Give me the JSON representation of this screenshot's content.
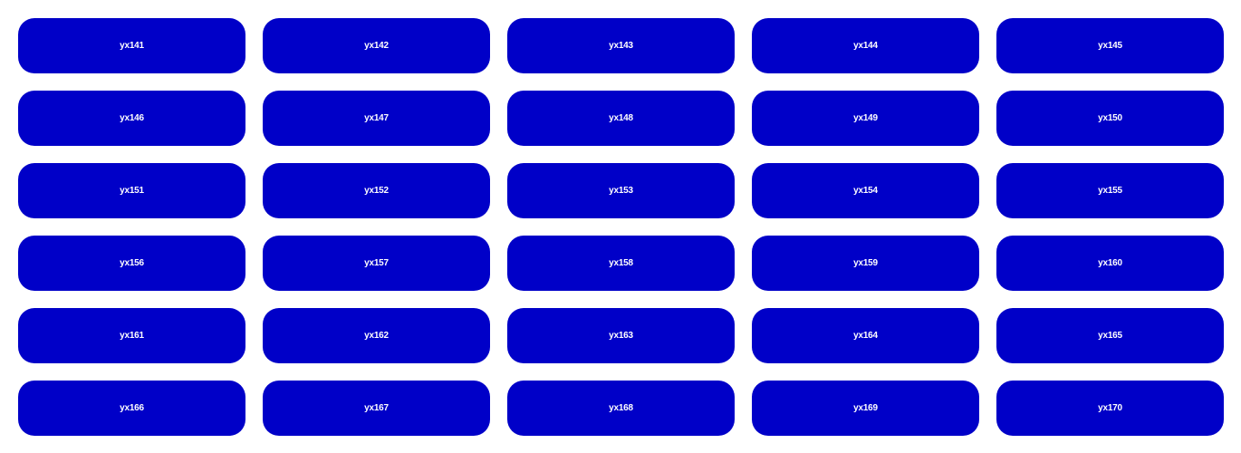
{
  "tile_color": "#0000c8",
  "label_color": "#ffffff",
  "tiles": [
    {
      "label": "yx141"
    },
    {
      "label": "yx142"
    },
    {
      "label": "yx143"
    },
    {
      "label": "yx144"
    },
    {
      "label": "yx145"
    },
    {
      "label": "yx146"
    },
    {
      "label": "yx147"
    },
    {
      "label": "yx148"
    },
    {
      "label": "yx149"
    },
    {
      "label": "yx150"
    },
    {
      "label": "yx151"
    },
    {
      "label": "yx152"
    },
    {
      "label": "yx153"
    },
    {
      "label": "yx154"
    },
    {
      "label": "yx155"
    },
    {
      "label": "yx156"
    },
    {
      "label": "yx157"
    },
    {
      "label": "yx158"
    },
    {
      "label": "yx159"
    },
    {
      "label": "yx160"
    },
    {
      "label": "yx161"
    },
    {
      "label": "yx162"
    },
    {
      "label": "yx163"
    },
    {
      "label": "yx164"
    },
    {
      "label": "yx165"
    },
    {
      "label": "yx166"
    },
    {
      "label": "yx167"
    },
    {
      "label": "yx168"
    },
    {
      "label": "yx169"
    },
    {
      "label": "yx170"
    }
  ]
}
